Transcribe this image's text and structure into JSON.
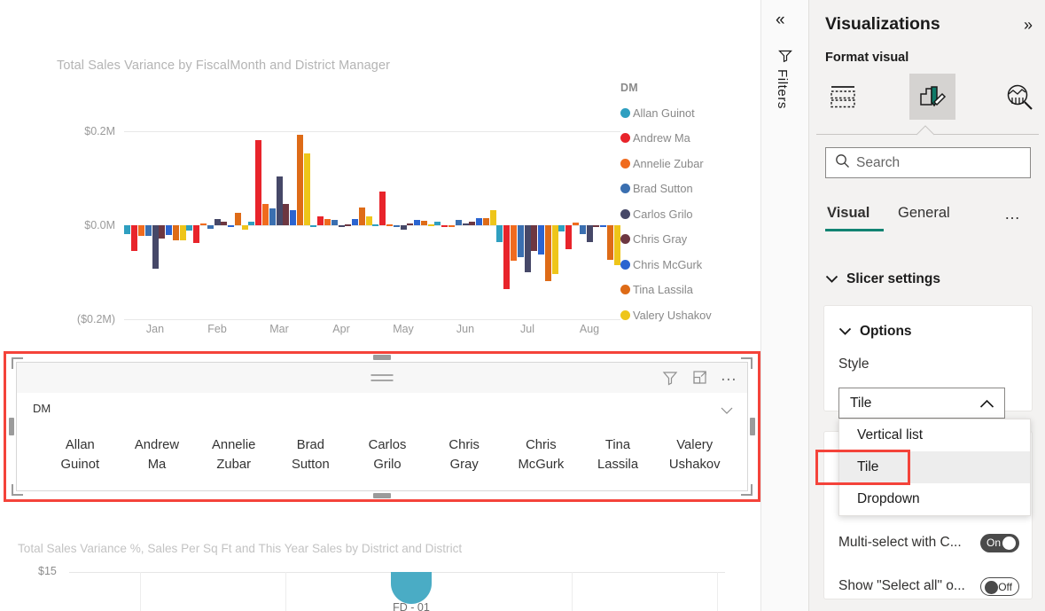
{
  "chart_data": {
    "type": "bar",
    "title": "Total Sales Variance by FiscalMonth and District Manager",
    "xlabel": "",
    "ylabel": "",
    "categories": [
      "Jan",
      "Feb",
      "Mar",
      "Apr",
      "May",
      "Jun",
      "Jul",
      "Aug"
    ],
    "ytick_labels": [
      "$0.2M",
      "$0.0M",
      "($0.2M)"
    ],
    "ytick_values": [
      0.2,
      0.0,
      -0.2
    ],
    "ylim": [
      -0.2,
      0.2
    ],
    "grid": true,
    "legend_title": "DM",
    "legend_position": "right",
    "series": [
      {
        "name": "Allan Guinot",
        "color": "#2f9fc0",
        "values": [
          -0.018,
          -0.012,
          0.008,
          -0.002,
          0.001,
          0.007,
          -0.035,
          -0.014
        ]
      },
      {
        "name": "Andrew Ma",
        "color": "#e8242b",
        "values": [
          -0.055,
          -0.038,
          0.181,
          0.019,
          0.071,
          -0.002,
          -0.135,
          -0.05
        ]
      },
      {
        "name": "Annelie Zubar",
        "color": "#f06b1e",
        "values": [
          -0.023,
          0.003,
          0.046,
          0.014,
          0.002,
          -0.004,
          -0.075,
          0.005
        ]
      },
      {
        "name": "Brad Sutton",
        "color": "#3a6fb0",
        "values": [
          -0.022,
          -0.008,
          0.036,
          0.012,
          -0.001,
          0.011,
          -0.068,
          -0.018
        ]
      },
      {
        "name": "Carlos Grilo",
        "color": "#464868",
        "values": [
          -0.092,
          0.013,
          0.104,
          -0.003,
          -0.01,
          0.004,
          -0.1,
          -0.036
        ]
      },
      {
        "name": "Chris Gray",
        "color": "#6d3741",
        "values": [
          -0.029,
          0.008,
          0.045,
          0.002,
          0.004,
          0.007,
          -0.055,
          -0.004
        ]
      },
      {
        "name": "Chris McGurk",
        "color": "#2b64d0",
        "values": [
          -0.02,
          -0.002,
          0.033,
          0.013,
          0.011,
          0.015,
          -0.062,
          -0.002
        ]
      },
      {
        "name": "Tina Lassila",
        "color": "#de6b17",
        "values": [
          -0.032,
          0.027,
          0.192,
          0.038,
          0.009,
          0.016,
          -0.118,
          -0.073
        ]
      },
      {
        "name": "Valery Ushakov",
        "color": "#eec51a",
        "values": [
          -0.033,
          -0.01,
          0.152,
          0.019,
          0.001,
          0.032,
          -0.104,
          -0.084
        ]
      }
    ]
  },
  "bottom_visual": {
    "title": "Total Sales Variance %, Sales Per Sq Ft and This Year Sales by District and District",
    "ytick": "$15",
    "category_label": "FD - 01",
    "blob_color": "#4aacc5"
  },
  "slicer": {
    "field_label": "DM",
    "items": [
      {
        "line1": "Allan",
        "line2": "Guinot"
      },
      {
        "line1": "Andrew",
        "line2": "Ma"
      },
      {
        "line1": "Annelie",
        "line2": "Zubar"
      },
      {
        "line1": "Brad",
        "line2": "Sutton"
      },
      {
        "line1": "Carlos",
        "line2": "Grilo"
      },
      {
        "line1": "Chris",
        "line2": "Gray"
      },
      {
        "line1": "Chris",
        "line2": "McGurk"
      },
      {
        "line1": "Tina",
        "line2": "Lassila"
      },
      {
        "line1": "Valery",
        "line2": "Ushakov"
      }
    ],
    "more_options": "…",
    "selection_color": "#f4433a"
  },
  "filters_rail": {
    "collapse_glyph": "«",
    "label": "Filters"
  },
  "viz_pane": {
    "title": "Visualizations",
    "expand_glyph": "»",
    "format_visual_label": "Format visual",
    "tabs": [
      {
        "name": "fields",
        "label": "Build visual"
      },
      {
        "name": "format",
        "label": "Format visual"
      },
      {
        "name": "analytics",
        "label": "Analytics"
      }
    ],
    "search": {
      "placeholder": "Search",
      "value": ""
    },
    "subtabs": [
      {
        "label": "Visual",
        "active": true
      },
      {
        "label": "General",
        "active": false
      }
    ],
    "subtabs_more": "…",
    "accent_color": "#118372",
    "slicer_settings_label": "Slicer settings",
    "options_label": "Options",
    "style_label": "Style",
    "style_value": "Tile",
    "style_options": [
      "Vertical list",
      "Tile",
      "Dropdown"
    ],
    "style_selected": "Tile",
    "settings_rows": [
      {
        "label": "Multi-select with C...",
        "state": "On"
      },
      {
        "label": "Show \"Select all\" o...",
        "state": "Off"
      }
    ]
  }
}
